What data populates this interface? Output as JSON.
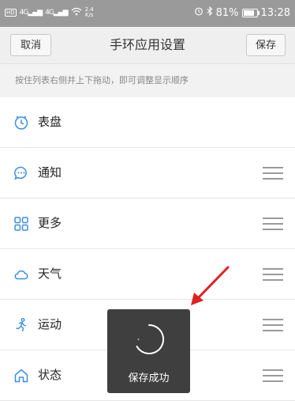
{
  "status_bar": {
    "net_left": "HD",
    "signal_1": "4G",
    "signal_2": "4G",
    "speed_value": "2.4",
    "speed_unit": "K/s",
    "battery": "81%",
    "battery_level": 0.81,
    "time": "13:28"
  },
  "header": {
    "cancel_label": "取消",
    "title": "手环应用设置",
    "save_label": "保存"
  },
  "hint": "按住列表右侧并上下拖动，即可调整显示顺序",
  "items": [
    {
      "label": "表盘",
      "icon": "clock-icon",
      "draggable": false
    },
    {
      "label": "通知",
      "icon": "chat-bubble-icon",
      "draggable": true
    },
    {
      "label": "更多",
      "icon": "grid-icon",
      "draggable": true
    },
    {
      "label": "天气",
      "icon": "cloud-icon",
      "draggable": true
    },
    {
      "label": "运动",
      "icon": "run-icon",
      "draggable": true
    },
    {
      "label": "状态",
      "icon": "home-icon",
      "draggable": true
    }
  ],
  "toast": {
    "message": "保存成功"
  },
  "colors": {
    "accent": "#3a8ee6",
    "annotation_arrow": "#e02020",
    "toast_bg": "#3f3f3f"
  }
}
